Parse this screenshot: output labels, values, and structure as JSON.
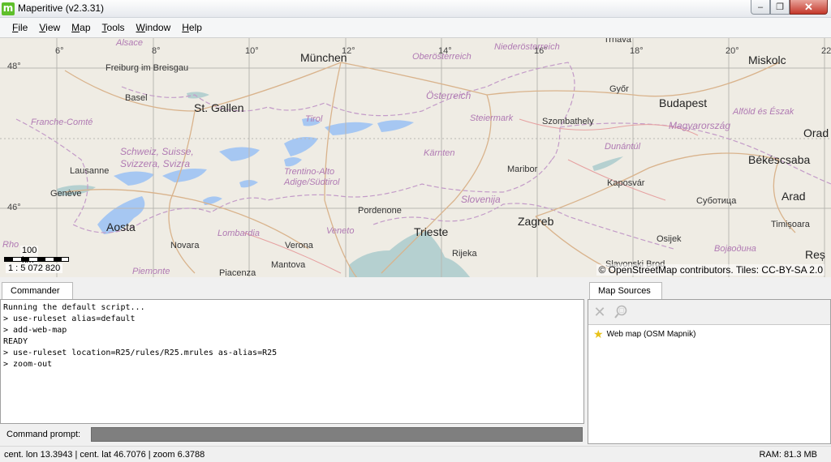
{
  "window": {
    "title": "Maperitive (v2.3.31)",
    "icon_letter": "m"
  },
  "menu": [
    {
      "label": "File",
      "u": "F",
      "rest": "ile"
    },
    {
      "label": "View",
      "u": "V",
      "rest": "iew"
    },
    {
      "label": "Map",
      "u": "M",
      "rest": "ap"
    },
    {
      "label": "Tools",
      "u": "T",
      "rest": "ools"
    },
    {
      "label": "Window",
      "u": "W",
      "rest": "indow"
    },
    {
      "label": "Help",
      "u": "H",
      "rest": "elp"
    }
  ],
  "map": {
    "longitude_ticks": [
      "6°",
      "8°",
      "10°",
      "12°",
      "14°",
      "16°",
      "18°",
      "20°",
      "22"
    ],
    "latitude_ticks": [
      "48°",
      "46°"
    ],
    "labels": {
      "muenchen": "München",
      "st_gallen": "St. Gallen",
      "budapest": "Budapest",
      "miskolc": "Miskolc",
      "oesterreich": "Österreich",
      "freiburg": "Freiburg im Breisgau",
      "basel": "Basel",
      "alsace": "Alsace",
      "franche_comte": "Franche-Comté",
      "schweiz": "Schweiz, Suisse,\nSvizzera, Svizra",
      "tirol": "Tirol",
      "steiermark": "Steiermark",
      "oberoesterreich": "Oberösterreich",
      "niederoesterreich": "Niederösterreich",
      "trnava": "Trnava",
      "gyor": "Győr",
      "szombathely": "Szombathely",
      "magyarorszag": "Magyarország",
      "alfold": "Alföld és Észak",
      "dunantul": "Dunántúl",
      "bekescsaba": "Békéscsaba",
      "orad": "Orad",
      "lausanne": "Lausanne",
      "geneve": "Genève",
      "trentino": "Trentino-Alto\nAdige/Südtirol",
      "kaernten": "Kärnten",
      "maribor": "Maribor",
      "kaposvar": "Kaposvár",
      "slovenija": "Slovenija",
      "subotica": "Суботица",
      "arad": "Arad",
      "aosta": "Aosta",
      "pordenone": "Pordenone",
      "zagreb": "Zagreb",
      "trieste": "Trieste",
      "timisoara": "Timișoara",
      "novara": "Novara",
      "lombardia": "Lombardia",
      "veneto": "Veneto",
      "verona": "Verona",
      "rijeka": "Rijeka",
      "osijek": "Osijek",
      "vojvodina": "Војводина",
      "mantova": "Mantova",
      "piemonte": "Piemonte",
      "piacenza": "Piacenza",
      "slavonski": "Slavonski Brod",
      "res": "Reș",
      "rho": "Rho"
    },
    "scale": {
      "distance": "100 km",
      "ratio": "1 : 5 072 820"
    },
    "attribution": "© OpenStreetMap contributors. Tiles: CC-BY-SA 2.0"
  },
  "commander": {
    "tab_label": "Commander",
    "console_lines": [
      "Running the default script...",
      "> use-ruleset alias=default",
      "> add-web-map",
      "READY",
      "> use-ruleset location=R25/rules/R25.mrules as-alias=R25",
      "> zoom-out"
    ],
    "prompt_label": "Command prompt:",
    "prompt_value": ""
  },
  "map_sources": {
    "tab_label": "Map Sources",
    "items": [
      {
        "label": "Web map (OSM Mapnik)",
        "icon": "star-icon"
      }
    ]
  },
  "status": {
    "position": "cent. lon 13.3943 | cent. lat 46.7076 | zoom 6.3788",
    "ram": "RAM: 81.3 MB"
  }
}
